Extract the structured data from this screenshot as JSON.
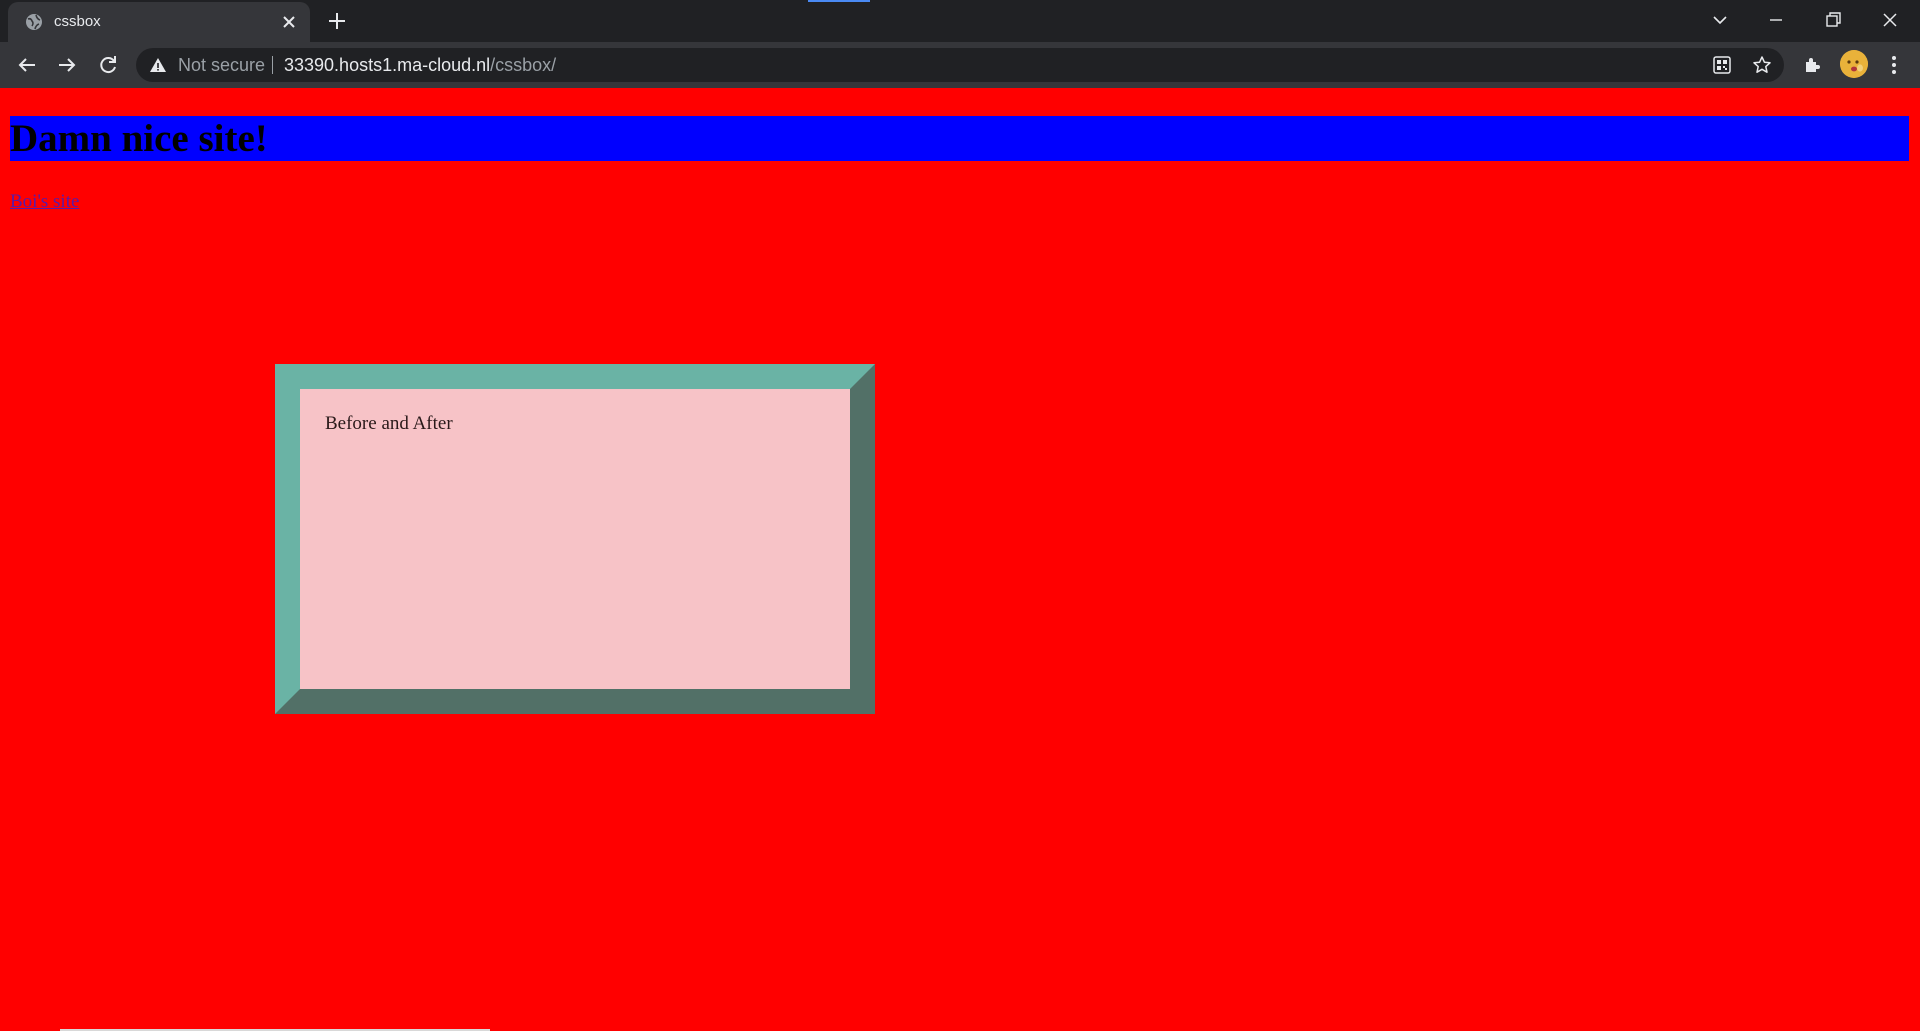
{
  "browser": {
    "tab": {
      "title": "cssbox",
      "favicon": "globe-icon"
    },
    "omnibox": {
      "security_label": "Not secure",
      "url_host": "33390.hosts1.ma-cloud.nl",
      "url_path": "/cssbox/"
    },
    "colors": {
      "frame": "#202124",
      "toolbar": "#35363a"
    }
  },
  "page": {
    "heading": "Damn nice site!",
    "link_text": "Boi's site",
    "box_text": "Before and After",
    "colors": {
      "background": "#ff0000",
      "heading_background": "#0000ff",
      "box_background": "#f7c3c7",
      "box_border_light": "#6ab3a5",
      "box_border_dark": "#527067"
    }
  }
}
